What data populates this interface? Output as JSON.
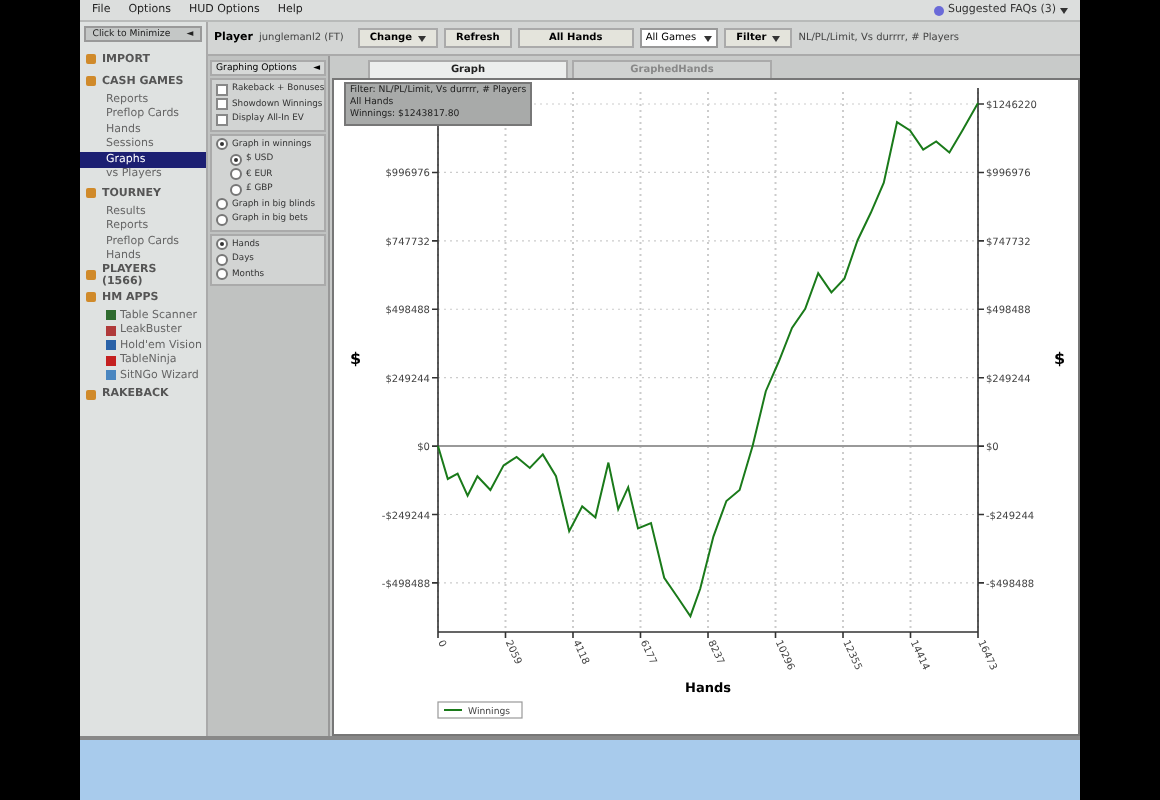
{
  "menu": [
    "File",
    "Options",
    "HUD Options",
    "Help"
  ],
  "faq": {
    "label": "Suggested FAQs (3)"
  },
  "sidebar": {
    "header": "Click to Minimize",
    "collapse_glyph": "◄",
    "sections": [
      {
        "label": "IMPORT"
      },
      {
        "label": "CASH GAMES",
        "children": [
          {
            "label": "Reports",
            "selected": false
          },
          {
            "label": "Preflop Cards",
            "selected": false
          },
          {
            "label": "Hands",
            "selected": false
          },
          {
            "label": "Sessions",
            "selected": false
          },
          {
            "label": "Graphs",
            "selected": true
          },
          {
            "label": "vs Players",
            "selected": false
          }
        ]
      },
      {
        "label": "TOURNEY",
        "children": [
          {
            "label": "Results",
            "selected": false
          },
          {
            "label": "Reports",
            "selected": false
          },
          {
            "label": "Preflop Cards",
            "selected": false
          },
          {
            "label": "Hands",
            "selected": false
          }
        ]
      },
      {
        "label": "PLAYERS (1566)"
      },
      {
        "label": "HM APPS",
        "children": [
          {
            "label": "Table Scanner",
            "selected": false,
            "color": "#2f6b2f"
          },
          {
            "label": "LeakBuster",
            "selected": false,
            "color": "#b03a3a"
          },
          {
            "label": "Hold'em Vision",
            "selected": false,
            "color": "#2a62a8"
          },
          {
            "label": "TableNinja",
            "selected": false,
            "color": "#c42020"
          },
          {
            "label": "SitNGo Wizard",
            "selected": false,
            "color": "#4a86c0"
          }
        ]
      },
      {
        "label": "RAKEBACK"
      }
    ]
  },
  "toolbar": {
    "player_label": "Player",
    "player": "junglemanl2 (FT)",
    "change": "Change",
    "refresh": "Refresh",
    "hands": "All Hands",
    "games": "All Games",
    "filter": "Filter",
    "filter_summary": "NL/PL/Limit, Vs durrrr, # Players"
  },
  "options": {
    "title": "Graphing Options",
    "collapse_glyph": "◄",
    "checks": [
      {
        "label": "Rakeback + Bonuses",
        "checked": false
      },
      {
        "label": "Showdown Winnings",
        "checked": false
      },
      {
        "label": "Display All-In EV",
        "checked": false
      }
    ],
    "modes": [
      {
        "label": "Graph in winnings",
        "selected": true,
        "children": [
          {
            "label": "$ USD",
            "selected": true
          },
          {
            "label": "€ EUR",
            "selected": false
          },
          {
            "label": "£ GBP",
            "selected": false
          }
        ]
      },
      {
        "label": "Graph in big blinds",
        "selected": false
      },
      {
        "label": "Graph in big bets",
        "selected": false
      }
    ],
    "scale": [
      {
        "label": "Hands",
        "selected": true
      },
      {
        "label": "Days",
        "selected": false
      },
      {
        "label": "Months",
        "selected": false
      }
    ]
  },
  "tabs": [
    {
      "label": "Graph",
      "selected": true
    },
    {
      "label": "GraphedHands",
      "selected": false
    }
  ],
  "info": [
    "Filter: NL/PL/Limit, Vs durrrr, # Players",
    "All Hands",
    "Winnings: $1243817.80"
  ],
  "chart_data": {
    "type": "line",
    "xlabel": "Hands",
    "ylabel": "$",
    "x": [
      0,
      300,
      600,
      900,
      1200,
      1600,
      2000,
      2400,
      2800,
      3200,
      3600,
      4000,
      4400,
      4800,
      5200,
      5500,
      5800,
      6100,
      6500,
      6900,
      7300,
      7700,
      8000,
      8400,
      8800,
      9200,
      9600,
      10000,
      10400,
      10800,
      11200,
      11600,
      12000,
      12400,
      12800,
      13200,
      13600,
      14000,
      14400,
      14800,
      15200,
      15600,
      16000,
      16473
    ],
    "series": [
      {
        "name": "Winnings",
        "color": "#1a7a1a",
        "values": [
          0,
          -120000,
          -100000,
          -180000,
          -110000,
          -160000,
          -70000,
          -40000,
          -80000,
          -30000,
          -110000,
          -310000,
          -220000,
          -260000,
          -60000,
          -230000,
          -150000,
          -300000,
          -280000,
          -480000,
          -550000,
          -620000,
          -520000,
          -330000,
          -200000,
          -160000,
          0,
          200000,
          310000,
          430000,
          500000,
          630000,
          560000,
          610000,
          750000,
          850000,
          960000,
          1180000,
          1150000,
          1080000,
          1110000,
          1070000,
          1150000,
          1250000
        ]
      }
    ],
    "grid": true,
    "xlim": [
      0,
      16473
    ],
    "ylim": [
      -670000,
      1290000
    ],
    "xticks": [
      0,
      2059,
      4118,
      6177,
      8237,
      10296,
      12355,
      14414,
      16473
    ],
    "yticks": [
      {
        "value": -498488,
        "label": "-$498488"
      },
      {
        "value": -249244,
        "label": "-$249244"
      },
      {
        "value": 0,
        "label": "$0"
      },
      {
        "value": 249244,
        "label": "$249244"
      },
      {
        "value": 498488,
        "label": "$498488"
      },
      {
        "value": 747732,
        "label": "$747732"
      },
      {
        "value": 996976,
        "label": "$996976"
      },
      {
        "value": 1246220,
        "label": "$1246220"
      }
    ]
  }
}
